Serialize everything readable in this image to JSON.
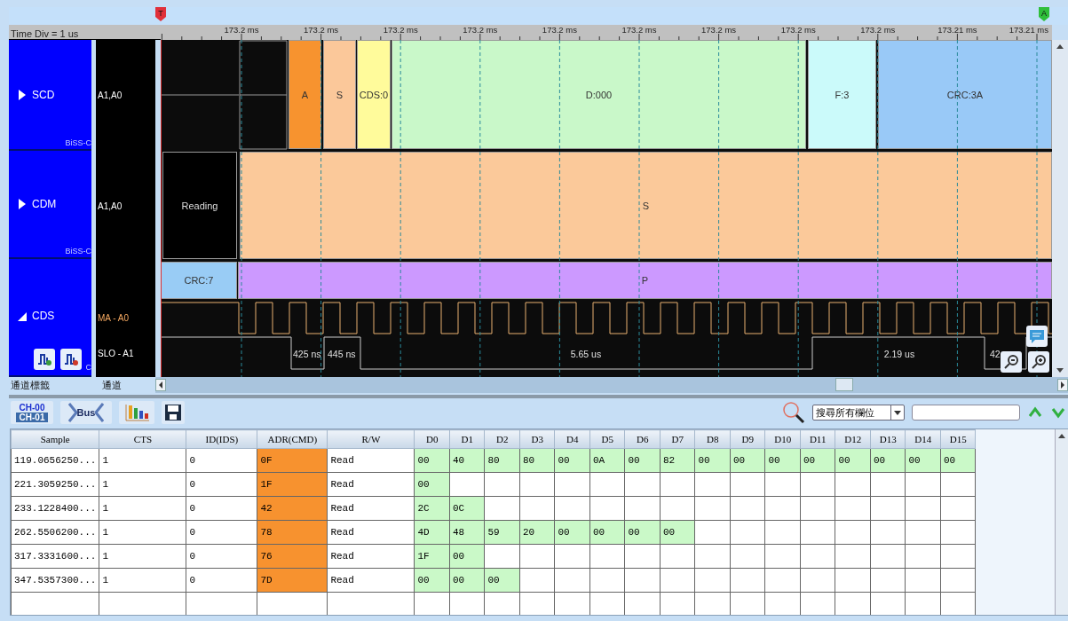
{
  "markers": [
    {
      "label": "T",
      "color": "#e0303a"
    },
    {
      "label": "A",
      "color": "#2fbf3a"
    }
  ],
  "time_div": "Time Div = 1 us",
  "ruler_ticks": [
    "173.2 ms",
    "173.2 ms",
    "173.2 ms",
    "173.2 ms",
    "173.2 ms",
    "173.2 ms",
    "173.2 ms",
    "173.2 ms",
    "173.2 ms",
    "173.21 ms",
    "173.21 ms"
  ],
  "channels": [
    {
      "name": "SCD",
      "expanded": false,
      "protocol": "BiSS-C",
      "signals": [
        {
          "name": "A1,A0",
          "color": "#ffffff"
        }
      ],
      "segments": [
        {
          "label": "A",
          "color": "#f7932f"
        },
        {
          "label": "S",
          "color": "#fbc89a"
        },
        {
          "label": "CDS:0",
          "color": "#fffb9b"
        },
        {
          "label": "D:000",
          "color": "#c9f8c9"
        },
        {
          "label": "F:3",
          "color": "#cbfafa"
        },
        {
          "label": "CRC:3A",
          "color": "#99c9f7"
        }
      ]
    },
    {
      "name": "CDM",
      "expanded": false,
      "protocol": "BiSS-C",
      "signals": [
        {
          "name": "A1,A0",
          "color": "#ffffff"
        }
      ],
      "segments": [
        {
          "label": "Reading",
          "color": "#000000"
        },
        {
          "label": "S",
          "color": "#fbc99a"
        }
      ]
    },
    {
      "name": "CDS",
      "expanded": true,
      "protocol": "C",
      "signals": [
        {
          "name": "MA - A0",
          "color": "#f5a860"
        },
        {
          "name": "SLO - A1",
          "color": "#ffffff"
        }
      ],
      "segments": [
        {
          "label": "CRC:7",
          "color": "#99ccf5"
        },
        {
          "label": "P",
          "color": "#cc99ff"
        }
      ],
      "pulse_labels": [
        "425 ns",
        "445 ns",
        "5.65 us",
        "2.19 us",
        "42"
      ]
    }
  ],
  "channel_footer": [
    "通道標籤",
    "通道"
  ],
  "toolbar": {
    "channel_icon": [
      "CH-00",
      "CH-01"
    ],
    "bus_icon": "Bus",
    "search_scope": "搜尋所有欄位"
  },
  "table": {
    "columns": [
      "Sample",
      "CTS",
      "ID(IDS)",
      "ADR(CMD)",
      "R/W",
      "D0",
      "D1",
      "D2",
      "D3",
      "D4",
      "D5",
      "D6",
      "D7",
      "D8",
      "D9",
      "D10",
      "D11",
      "D12",
      "D13",
      "D14",
      "D15"
    ],
    "rows": [
      [
        "119.0656250...",
        "1",
        "0",
        "0F",
        "Read",
        "00",
        "40",
        "80",
        "80",
        "00",
        "0A",
        "00",
        "82",
        "00",
        "00",
        "00",
        "00",
        "00",
        "00",
        "00",
        "00"
      ],
      [
        "221.3059250...",
        "1",
        "0",
        "1F",
        "Read",
        "00"
      ],
      [
        "233.1228400...",
        "1",
        "0",
        "42",
        "Read",
        "2C",
        "0C"
      ],
      [
        "262.5506200...",
        "1",
        "0",
        "78",
        "Read",
        "4D",
        "48",
        "59",
        "20",
        "00",
        "00",
        "00",
        "00"
      ],
      [
        "317.3331600...",
        "1",
        "0",
        "76",
        "Read",
        "1F",
        "00"
      ],
      [
        "347.5357300...",
        "1",
        "0",
        "7D",
        "Read",
        "00",
        "00",
        "00"
      ]
    ]
  }
}
